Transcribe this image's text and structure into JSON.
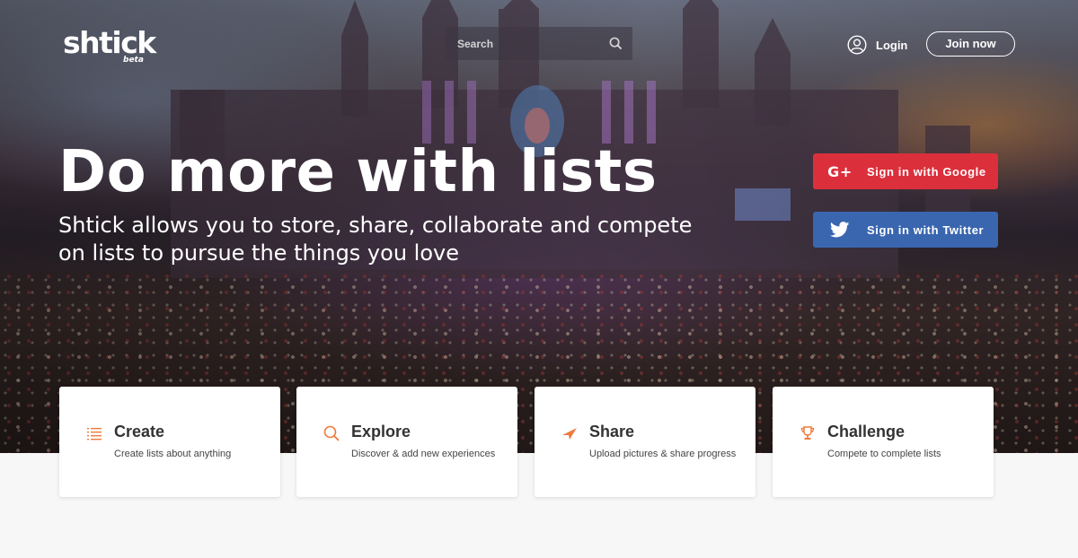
{
  "header": {
    "logo_text": "shtick",
    "logo_badge": "beta",
    "search_placeholder": "Search",
    "login_label": "Login",
    "join_label": "Join now"
  },
  "hero": {
    "headline": "Do more with lists",
    "subline": "Shtick allows you to store, share, collaborate and compete on lists to pursue the things you love"
  },
  "auth": {
    "google_label": "Sign in with Google",
    "twitter_label": "Sign in with Twitter"
  },
  "features": [
    {
      "title": "Create",
      "description": "Create lists about anything",
      "icon": "list-icon"
    },
    {
      "title": "Explore",
      "description": "Discover & add new experiences",
      "icon": "search-icon"
    },
    {
      "title": "Share",
      "description": "Upload pictures & share progress",
      "icon": "send-icon"
    },
    {
      "title": "Challenge",
      "description": "Compete to complete lists",
      "icon": "trophy-icon"
    }
  ],
  "colors": {
    "accent_orange": "#f07a3e",
    "google_red": "#dc2f3c",
    "twitter_blue": "#3a66b0",
    "page_background": "#f7f7f7"
  }
}
